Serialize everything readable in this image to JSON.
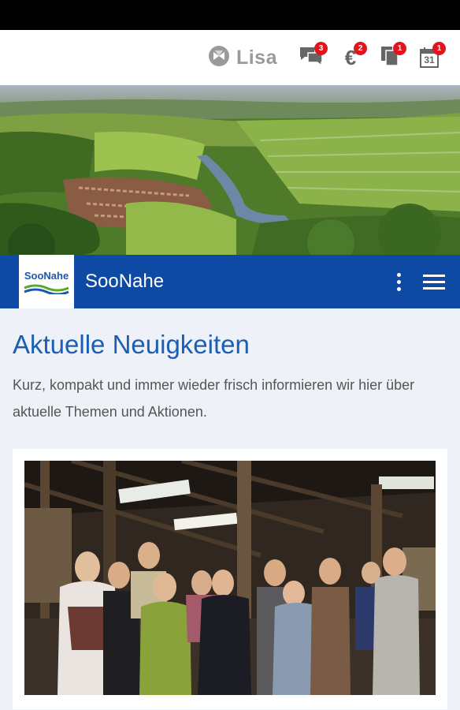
{
  "topbar": {
    "user_name": "Lisa",
    "icons": [
      {
        "name": "messages-icon",
        "badge": "3"
      },
      {
        "name": "euro-icon",
        "badge": "2"
      },
      {
        "name": "documents-icon",
        "badge": "1"
      },
      {
        "name": "calendar-icon",
        "badge": "1",
        "date": "31"
      }
    ]
  },
  "brand": {
    "logo_text": "SooNahe",
    "name": "SooNahe"
  },
  "main": {
    "heading": "Aktuelle Neuigkeiten",
    "intro": "Kurz, kompakt und immer wieder frisch informieren wir hier über aktuelle Themen und Aktionen."
  },
  "colors": {
    "brand_blue": "#0e4aa3",
    "heading_blue": "#1a5fb4",
    "badge_red": "#e3141b"
  }
}
